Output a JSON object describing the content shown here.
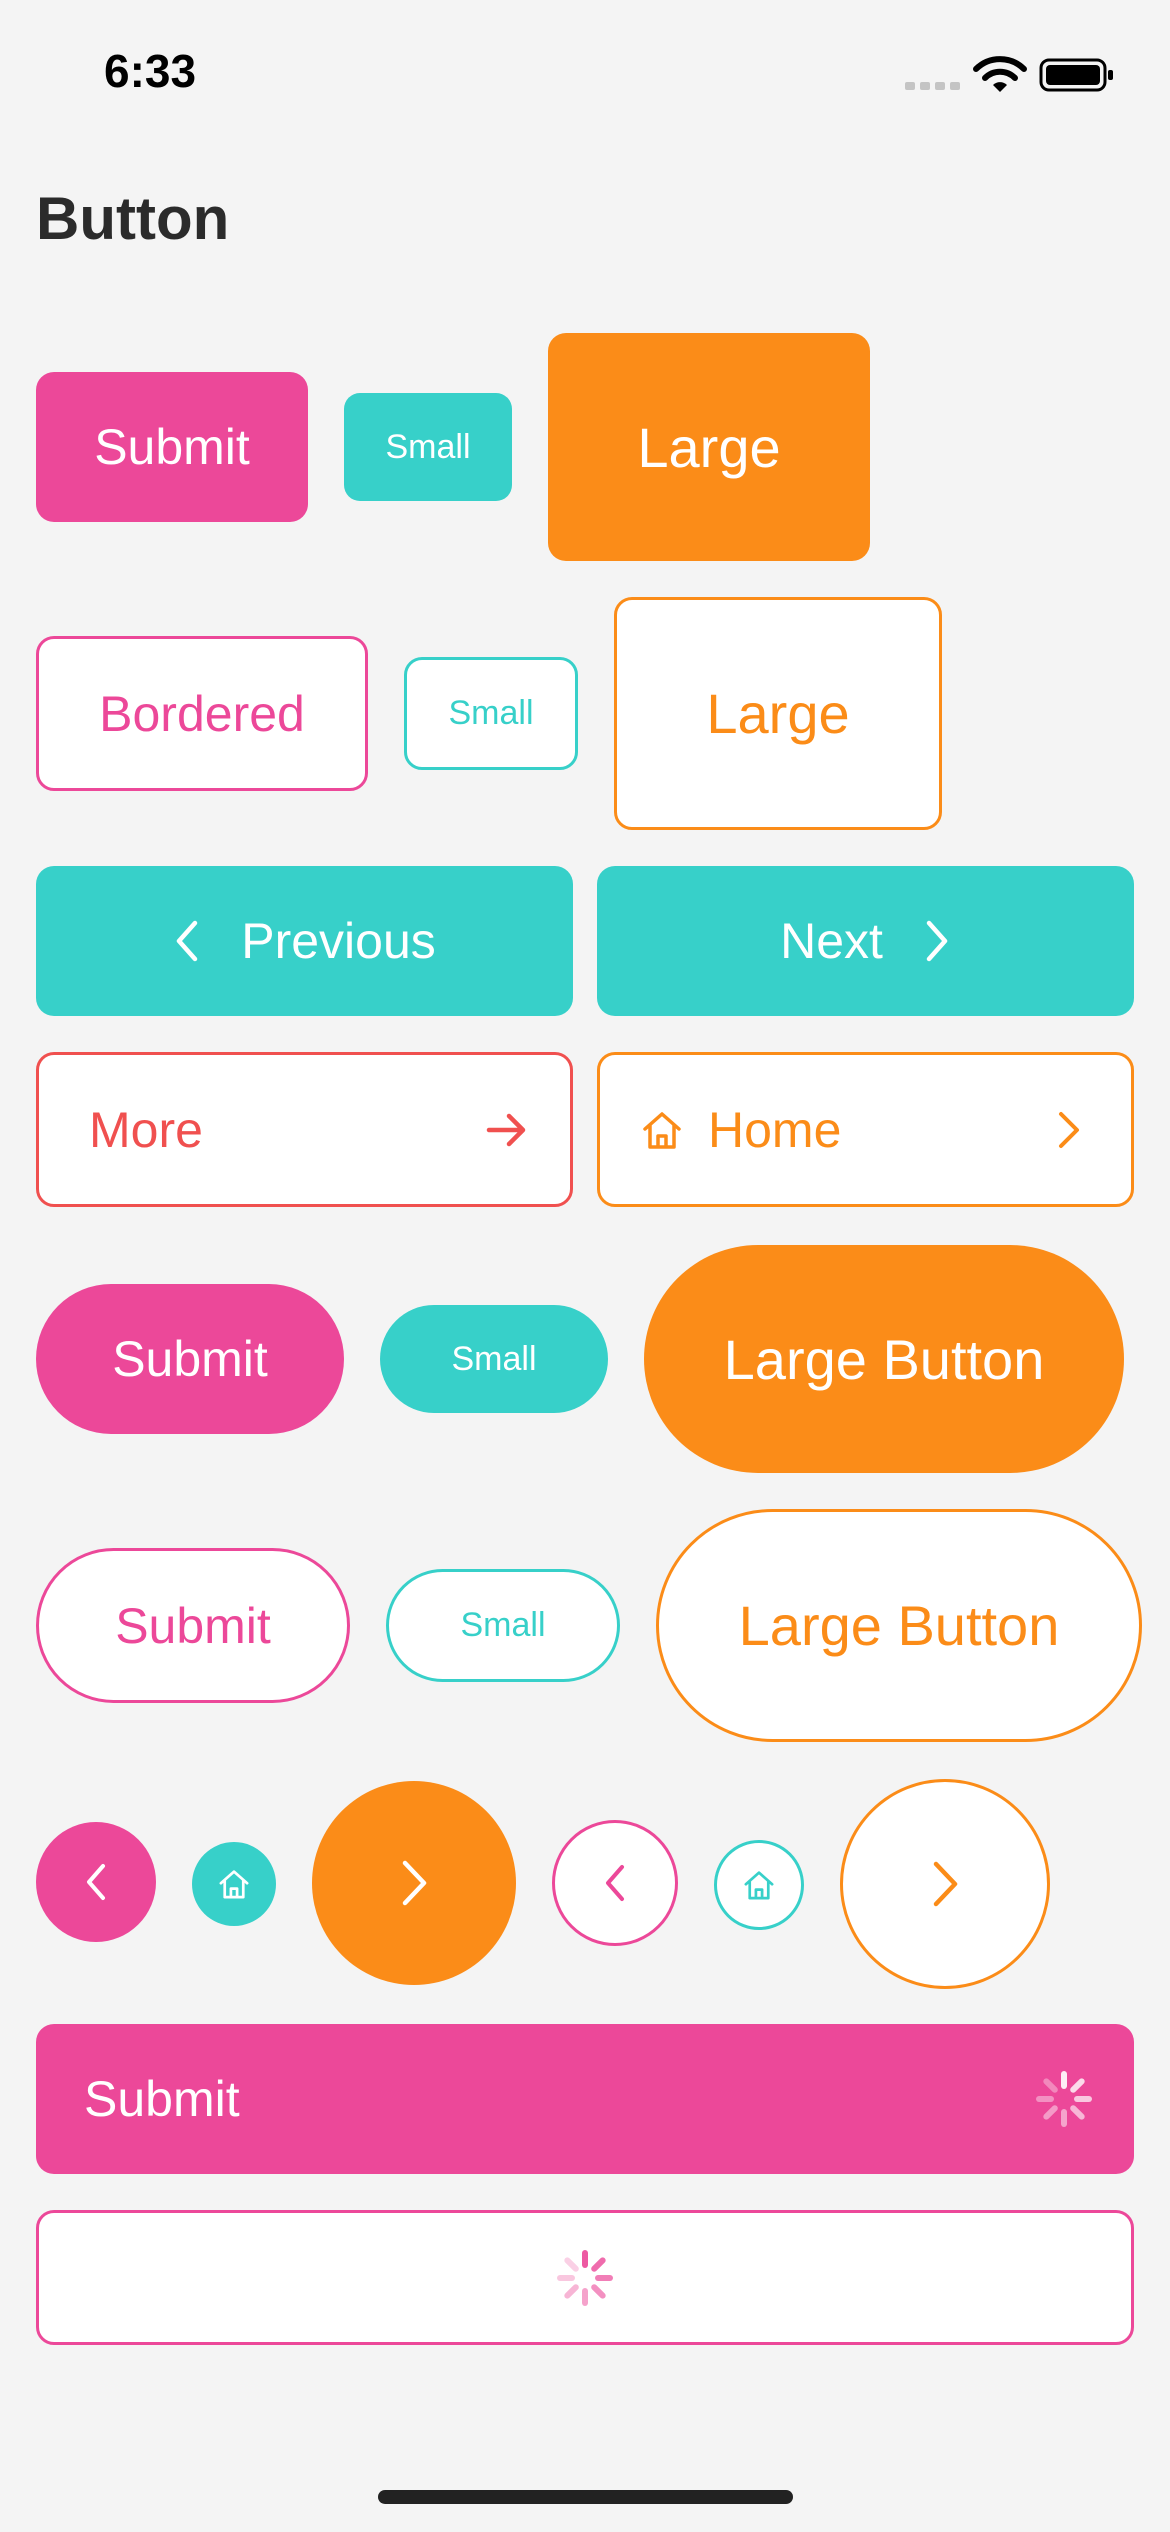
{
  "status_bar": {
    "time": "6:33"
  },
  "page": {
    "title": "Button"
  },
  "rows": {
    "r1": {
      "submit": "Submit",
      "small": "Small",
      "large": "Large"
    },
    "r2": {
      "bordered": "Bordered",
      "small": "Small",
      "large": "Large"
    },
    "r3": {
      "previous": "Previous",
      "next": "Next"
    },
    "r4": {
      "more": "More",
      "home": "Home"
    },
    "r5": {
      "submit": "Submit",
      "small": "Small",
      "large": "Large Button"
    },
    "r6": {
      "submit": "Submit",
      "small": "Small",
      "large": "Large Button"
    },
    "r8": {
      "submit": "Submit"
    }
  },
  "colors": {
    "pink": "#ec4899",
    "teal": "#37d0c9",
    "orange": "#fb8c18",
    "red": "#f0504f",
    "background": "#f4f4f4"
  },
  "icons": [
    "chevron-left-icon",
    "chevron-right-icon",
    "arrow-right-icon",
    "home-icon",
    "spinner-icon",
    "wifi-icon",
    "battery-icon",
    "cellular-icon"
  ]
}
